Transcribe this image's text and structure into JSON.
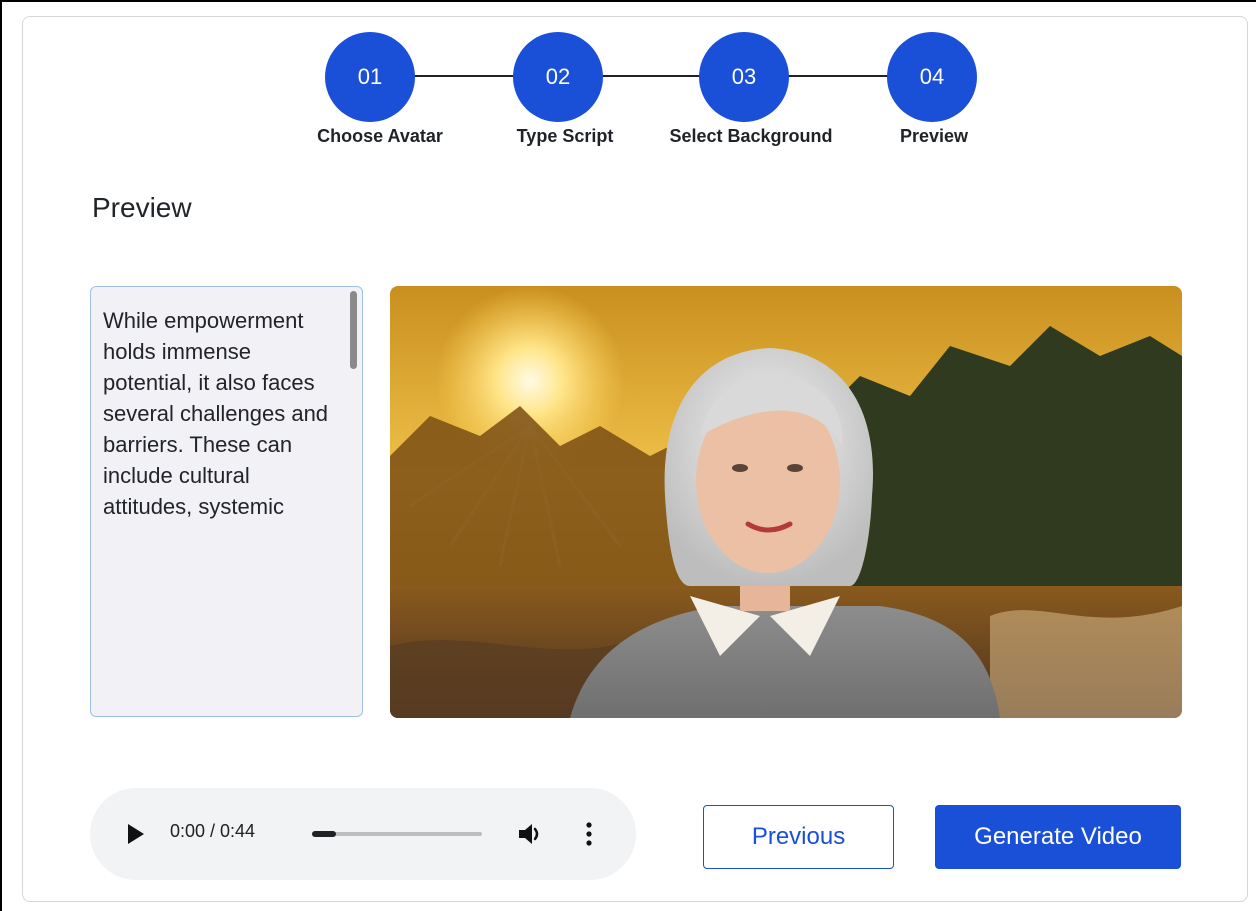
{
  "stepper": {
    "steps": [
      {
        "number": "01",
        "label": "Choose Avatar"
      },
      {
        "number": "02",
        "label": "Type Script"
      },
      {
        "number": "03",
        "label": "Select Background"
      },
      {
        "number": "04",
        "label": "Preview"
      }
    ],
    "active_color": "#1a4fd8"
  },
  "preview": {
    "title": "Preview",
    "script_text": "While empowerment holds immense potential, it also faces several challenges and barriers. These can include cultural attitudes, systemic"
  },
  "audio": {
    "time": "0:00 / 0:44",
    "progress": 0.14,
    "icons": [
      "play-icon",
      "volume-icon",
      "more-options-icon"
    ]
  },
  "actions": {
    "previous_label": "Previous",
    "generate_label": "Generate Video"
  },
  "colors": {
    "primary": "#1a4fd8",
    "script_bg": "#f1f1f6",
    "script_border": "#9fc0ea",
    "audio_bg": "#f1f3f4"
  }
}
